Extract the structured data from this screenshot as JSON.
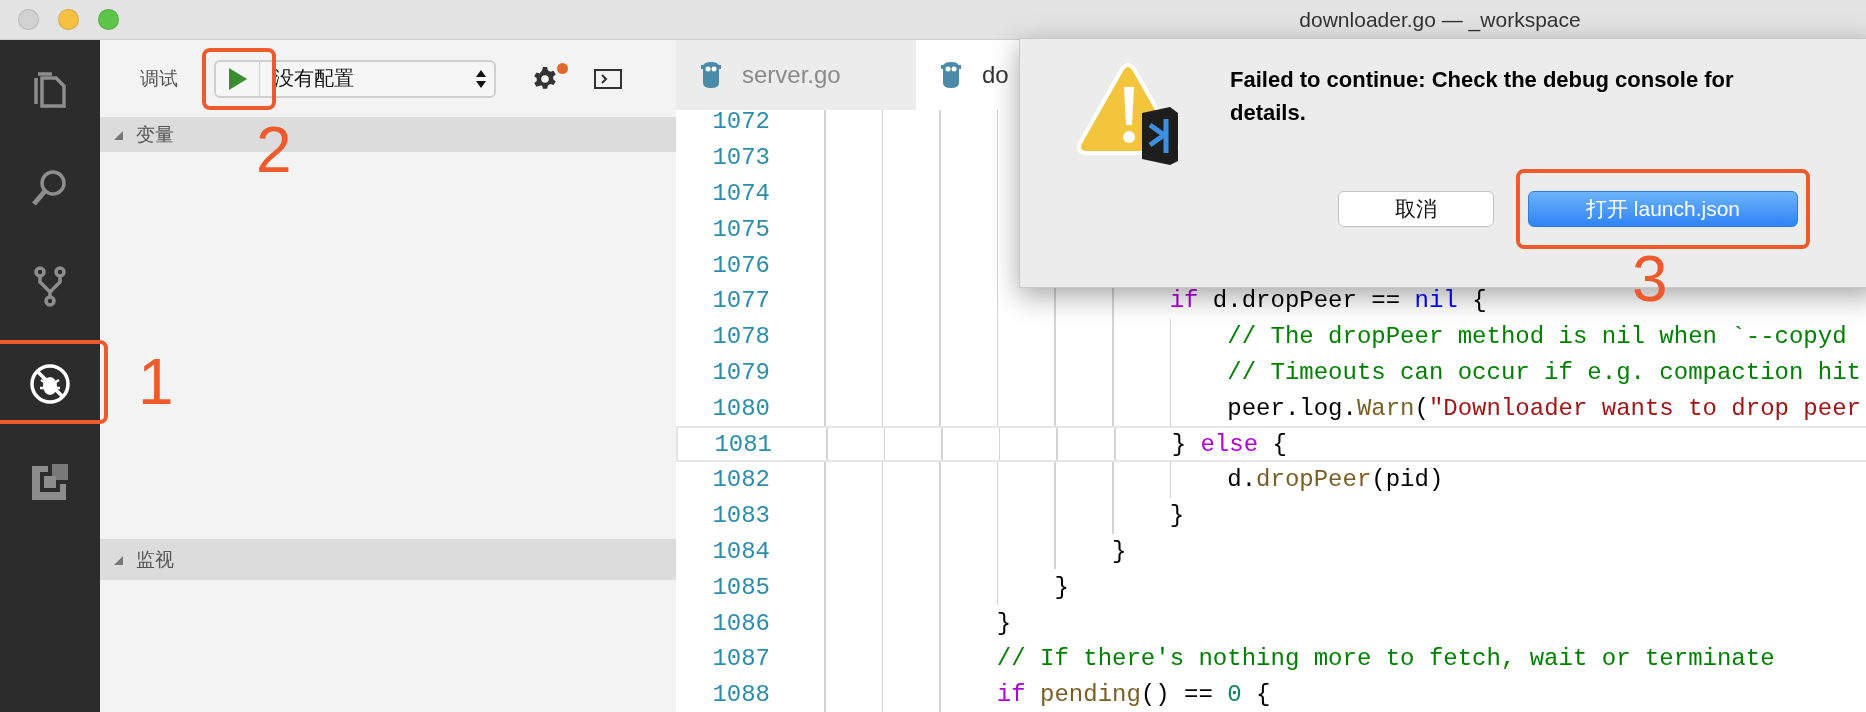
{
  "window": {
    "title": "downloader.go — _workspace"
  },
  "activity_bar": [
    {
      "kind": "files",
      "selected": false
    },
    {
      "kind": "search",
      "selected": false
    },
    {
      "kind": "source-control",
      "selected": false
    },
    {
      "kind": "debug",
      "selected": true,
      "annotation": {
        "label": "1"
      }
    },
    {
      "kind": "extensions",
      "selected": false
    }
  ],
  "sidebar": {
    "title": "调试",
    "toolbar": {
      "configuration": "没有配置",
      "settings_badge": true,
      "annotation": {
        "label": "2"
      }
    },
    "sections": [
      {
        "title": "变量",
        "expanded": true
      },
      {
        "title": "监视",
        "expanded": true
      }
    ]
  },
  "tabs": [
    {
      "label": "server.go",
      "selected": false
    },
    {
      "label": "do",
      "selected": true
    }
  ],
  "editor": {
    "lines": [
      {
        "number": "1072",
        "highlighted": false
      },
      {
        "number": "1073",
        "highlighted": false
      },
      {
        "number": "1074",
        "highlighted": false
      },
      {
        "number": "1075",
        "highlighted": false
      },
      {
        "number": "1076",
        "highlighted": false
      },
      {
        "number": "1077",
        "highlighted": false,
        "tokens": [
          {
            "kind": "keyword",
            "text": "                        if"
          },
          {
            "kind": "plain",
            "text": " d.dropPeer == "
          },
          {
            "kind": "constant",
            "text": "nil"
          },
          {
            "kind": "plain",
            "text": " {"
          }
        ]
      },
      {
        "number": "1078",
        "highlighted": false,
        "tokens": [
          {
            "kind": "comment",
            "text": "                            // The dropPeer method is nil when `--copyd"
          }
        ]
      },
      {
        "number": "1079",
        "highlighted": false,
        "tokens": [
          {
            "kind": "comment",
            "text": "                            // Timeouts can occur if e.g. compaction hit"
          }
        ]
      },
      {
        "number": "1080",
        "highlighted": false,
        "tokens": [
          {
            "kind": "plain",
            "text": "                            peer.log."
          },
          {
            "kind": "function",
            "text": "Warn"
          },
          {
            "kind": "plain",
            "text": "("
          },
          {
            "kind": "string",
            "text": "\"Downloader wants to drop peer"
          }
        ]
      },
      {
        "number": "1081",
        "highlighted": true,
        "tokens": [
          {
            "kind": "plain",
            "text": "                        } "
          },
          {
            "kind": "keyword",
            "text": "else"
          },
          {
            "kind": "plain",
            "text": " {"
          }
        ]
      },
      {
        "number": "1082",
        "highlighted": false,
        "tokens": [
          {
            "kind": "plain",
            "text": "                            d."
          },
          {
            "kind": "function",
            "text": "dropPeer"
          },
          {
            "kind": "plain",
            "text": "(pid)"
          }
        ]
      },
      {
        "number": "1083",
        "highlighted": false,
        "tokens": [
          {
            "kind": "plain",
            "text": "                        }"
          }
        ]
      },
      {
        "number": "1084",
        "highlighted": false,
        "tokens": [
          {
            "kind": "plain",
            "text": "                    }"
          }
        ]
      },
      {
        "number": "1085",
        "highlighted": false,
        "tokens": [
          {
            "kind": "plain",
            "text": "                }"
          }
        ]
      },
      {
        "number": "1086",
        "highlighted": false,
        "tokens": [
          {
            "kind": "plain",
            "text": "            }"
          }
        ]
      },
      {
        "number": "1087",
        "highlighted": false,
        "tokens": [
          {
            "kind": "comment",
            "text": "            // If there's nothing more to fetch, wait or terminate"
          }
        ]
      },
      {
        "number": "1088",
        "highlighted": false,
        "tokens": [
          {
            "kind": "keyword",
            "text": "            if"
          },
          {
            "kind": "function",
            "text": " pending"
          },
          {
            "kind": "plain",
            "text": "() == "
          },
          {
            "kind": "number",
            "text": "0"
          },
          {
            "kind": "plain",
            "text": " {"
          }
        ]
      }
    ]
  },
  "dialog": {
    "message": "Failed to continue: Check the debug console for details.",
    "buttons": [
      {
        "label": "取消",
        "default": false
      },
      {
        "label": "打开 launch.json",
        "default": true,
        "annotation": {
          "label": "3"
        }
      }
    ]
  }
}
